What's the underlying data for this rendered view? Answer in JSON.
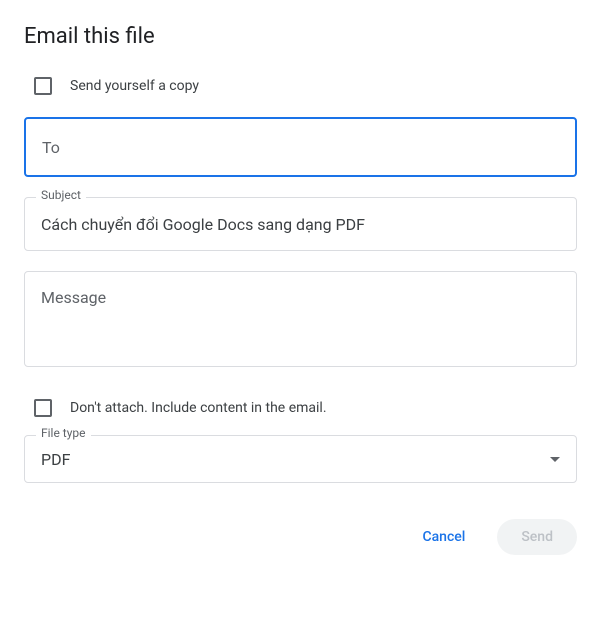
{
  "title": "Email this file",
  "send_yourself": {
    "label": "Send yourself a copy",
    "checked": false
  },
  "to": {
    "placeholder": "To",
    "value": ""
  },
  "subject": {
    "legend": "Subject",
    "value": "Cách chuyển đổi Google Docs sang dạng PDF"
  },
  "message": {
    "placeholder": "Message",
    "value": ""
  },
  "dont_attach": {
    "label": "Don't attach. Include content in the email.",
    "checked": false
  },
  "file_type": {
    "legend": "File type",
    "value": "PDF"
  },
  "actions": {
    "cancel": "Cancel",
    "send": "Send"
  }
}
